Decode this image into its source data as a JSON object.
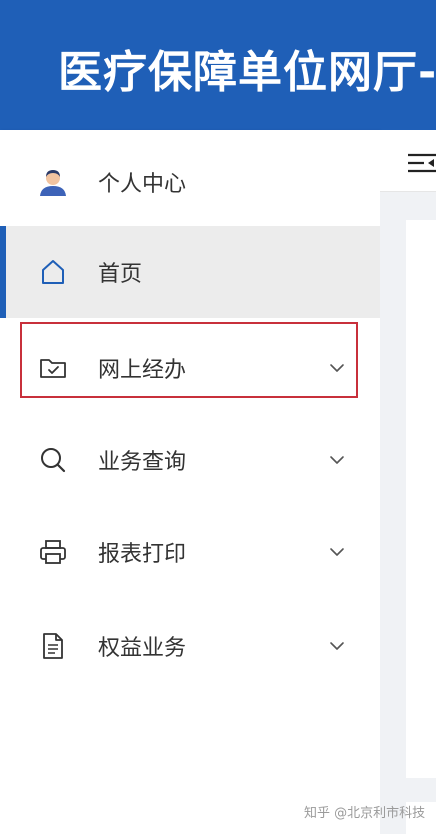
{
  "header": {
    "title": "医疗保障单位网厅-"
  },
  "sidebar": {
    "items": [
      {
        "label": "个人中心",
        "icon": "user-avatar-icon"
      },
      {
        "label": "首页",
        "icon": "home-icon"
      },
      {
        "label": "网上经办",
        "icon": "folder-check-icon",
        "expandable": true
      },
      {
        "label": "业务查询",
        "icon": "search-icon",
        "expandable": true
      },
      {
        "label": "报表打印",
        "icon": "printer-icon",
        "expandable": true
      },
      {
        "label": "权益业务",
        "icon": "document-icon",
        "expandable": true
      }
    ],
    "active_item": "首页",
    "highlighted_item": "网上经办"
  },
  "toolbar": {
    "collapse_icon": "menu-collapse-icon"
  },
  "watermark": "知乎 @北京利市科技",
  "colors": {
    "header_bg": "#1f5fb7",
    "active_indicator": "#1f5fb7",
    "active_bg": "#ececec",
    "highlight_border": "#c8303b",
    "text": "#333333",
    "content_bg": "#f0f2f5"
  }
}
